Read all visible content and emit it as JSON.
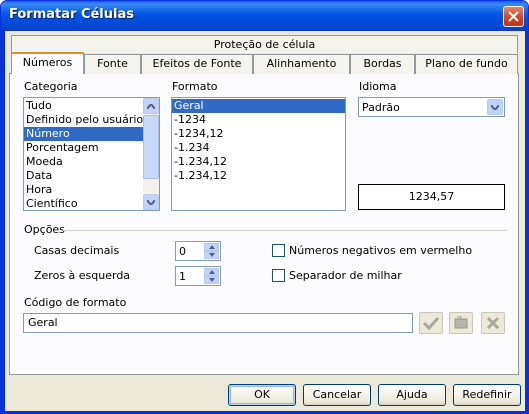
{
  "window": {
    "title": "Formatar Células"
  },
  "tabs": {
    "top_row": [
      {
        "label": "Proteção de célula"
      }
    ],
    "bottom_row": [
      {
        "label": "Números",
        "active": true
      },
      {
        "label": "Fonte"
      },
      {
        "label": "Efeitos de Fonte"
      },
      {
        "label": "Alinhamento"
      },
      {
        "label": "Bordas"
      },
      {
        "label": "Plano de fundo"
      }
    ]
  },
  "categoria": {
    "label": "Categoria",
    "items": [
      "Tudo",
      "Definido pelo usuário",
      "Número",
      "Porcentagem",
      "Moeda",
      "Data",
      "Hora",
      "Científico"
    ],
    "selected": "Número"
  },
  "formato": {
    "label": "Formato",
    "items": [
      "Geral",
      "-1234",
      "-1234,12",
      "-1.234",
      "-1.234,12",
      "-1.234,12"
    ],
    "selected": "Geral"
  },
  "idioma": {
    "label": "Idioma",
    "value": "Padrão"
  },
  "preview": {
    "value": "1234,57"
  },
  "opcoes": {
    "label": "Opções",
    "casas_decimais": {
      "label": "Casas decimais",
      "value": "0"
    },
    "zeros_esquerda": {
      "label": "Zeros à esquerda",
      "value": "1"
    },
    "negativos_vermelho": {
      "label": "Números negativos em vermelho",
      "checked": false
    },
    "separador_milhar": {
      "label": "Separador de milhar",
      "checked": false
    }
  },
  "codigo_formato": {
    "label": "Código de formato",
    "value": "Geral"
  },
  "buttons": {
    "ok": "OK",
    "cancel": "Cancelar",
    "help": "Ajuda",
    "reset": "Redefinir"
  },
  "icons": {
    "accept": "checkmark-icon",
    "add": "add-comment-icon",
    "delete": "delete-x-icon",
    "close": "close-icon"
  },
  "colors": {
    "titlebar": "#0055e5",
    "selection": "#316ac5",
    "dialog_bg": "#ece9d8"
  }
}
